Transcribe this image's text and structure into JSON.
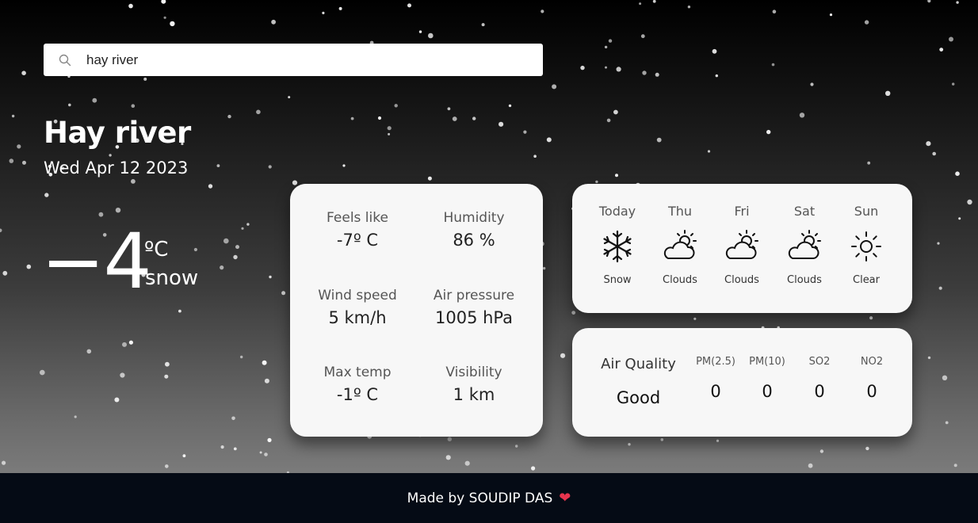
{
  "search": {
    "value": "hay river",
    "icon": "search-icon"
  },
  "location": {
    "city": "Hay river",
    "date": "Wed Apr 12 2023"
  },
  "current": {
    "temp": "−4",
    "unit": "ºC",
    "condition": "snow"
  },
  "details": [
    {
      "label": "Feels like",
      "value": "-7º C"
    },
    {
      "label": "Humidity",
      "value": "86 %"
    },
    {
      "label": "Wind speed",
      "value": "5 km/h"
    },
    {
      "label": "Air pressure",
      "value": "1005 hPa"
    },
    {
      "label": "Max temp",
      "value": "-1º C"
    },
    {
      "label": "Visibility",
      "value": "1 km"
    }
  ],
  "forecast": [
    {
      "day": "Today",
      "icon": "snowflake-icon",
      "condition": "Snow"
    },
    {
      "day": "Thu",
      "icon": "cloud-sun-icon",
      "condition": "Clouds"
    },
    {
      "day": "Fri",
      "icon": "cloud-sun-icon",
      "condition": "Clouds"
    },
    {
      "day": "Sat",
      "icon": "cloud-sun-icon",
      "condition": "Clouds"
    },
    {
      "day": "Sun",
      "icon": "sun-icon",
      "condition": "Clear"
    }
  ],
  "air_quality": {
    "title": "Air Quality",
    "value": "Good",
    "pollutants": [
      {
        "name": "PM(2.5)",
        "value": "0"
      },
      {
        "name": "PM(10)",
        "value": "0"
      },
      {
        "name": "SO2",
        "value": "0"
      },
      {
        "name": "NO2",
        "value": "0"
      }
    ]
  },
  "footer": {
    "text": "Made by SOUDIP DAS",
    "icon": "heart-icon"
  },
  "colors": {
    "card_bg": "#f7f7f7",
    "footer_bg": "#050b15",
    "heart": "#e8344e"
  }
}
